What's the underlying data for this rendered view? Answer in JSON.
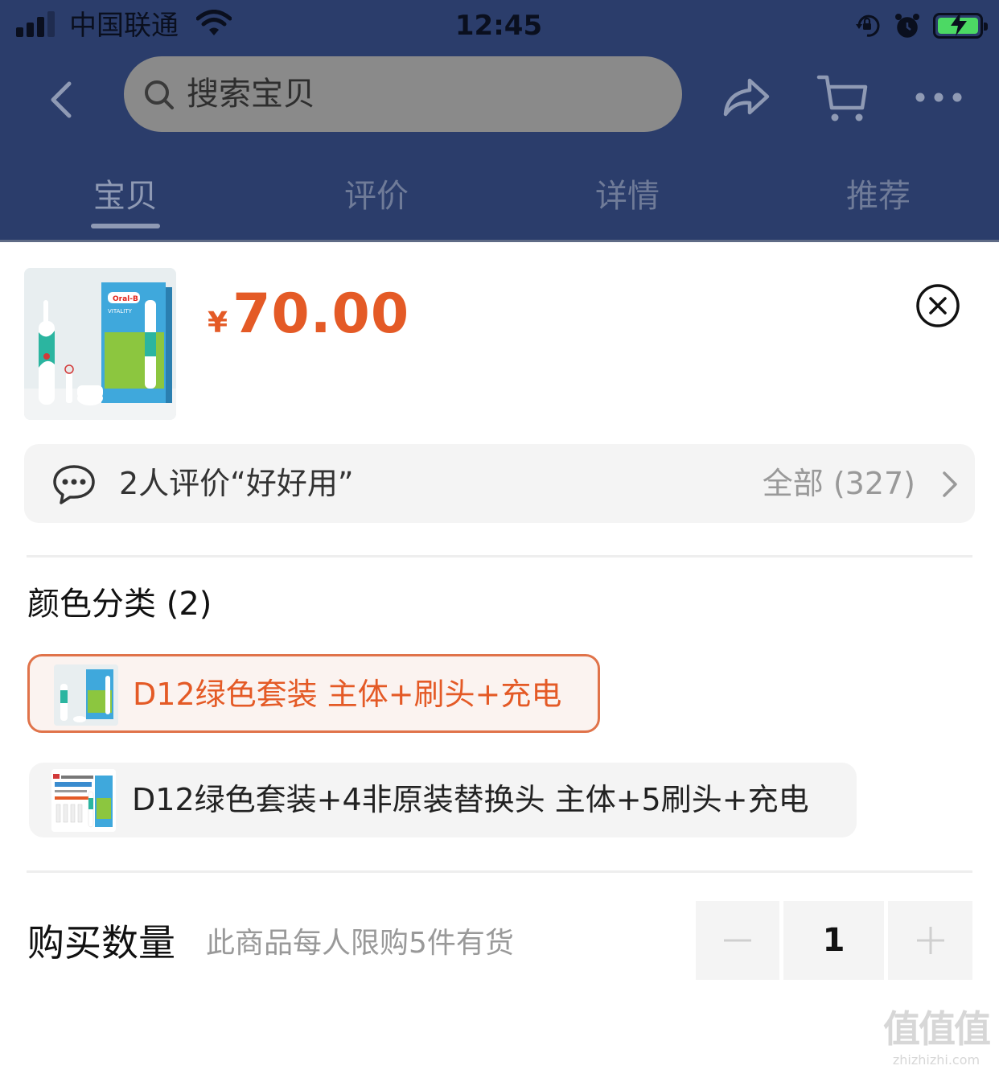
{
  "status_bar": {
    "carrier": "中国联通",
    "time": "12:45",
    "icons": [
      "signal-icon",
      "wifi-icon",
      "orientation-lock-icon",
      "alarm-icon",
      "battery-charging-icon"
    ]
  },
  "nav": {
    "search_placeholder": "搜索宝贝",
    "icons": [
      "back-icon",
      "share-icon",
      "cart-icon",
      "more-icon"
    ]
  },
  "tabs": [
    {
      "label": "宝贝",
      "active": true
    },
    {
      "label": "评价",
      "active": false
    },
    {
      "label": "详情",
      "active": false
    },
    {
      "label": "推荐",
      "active": false
    }
  ],
  "product": {
    "currency": "¥",
    "price": "70.00",
    "brand_text": "Oral-B",
    "model_text": "VITALITY"
  },
  "review": {
    "summary": "2人评价“好好用”",
    "all_label": "全部 (327)"
  },
  "color_section": {
    "title": "颜色分类 (2)",
    "options": [
      {
        "label": "D12绿色套装 主体+刷头+充电",
        "selected": true
      },
      {
        "label": "D12绿色套装+4非原装替换头 主体+5刷头+充电",
        "selected": false
      }
    ]
  },
  "quantity": {
    "title": "购买数量",
    "note": "此商品每人限购5件有货",
    "value": "1",
    "minus": "−",
    "plus": "+"
  },
  "watermark": {
    "glyphs": "值值值",
    "url": "zhizhizhi.com"
  },
  "colors": {
    "header_bg": "#2b3d6b",
    "accent": "#e45a26",
    "selected_border": "#e0734a",
    "chip_bg": "#f4f4f4"
  }
}
